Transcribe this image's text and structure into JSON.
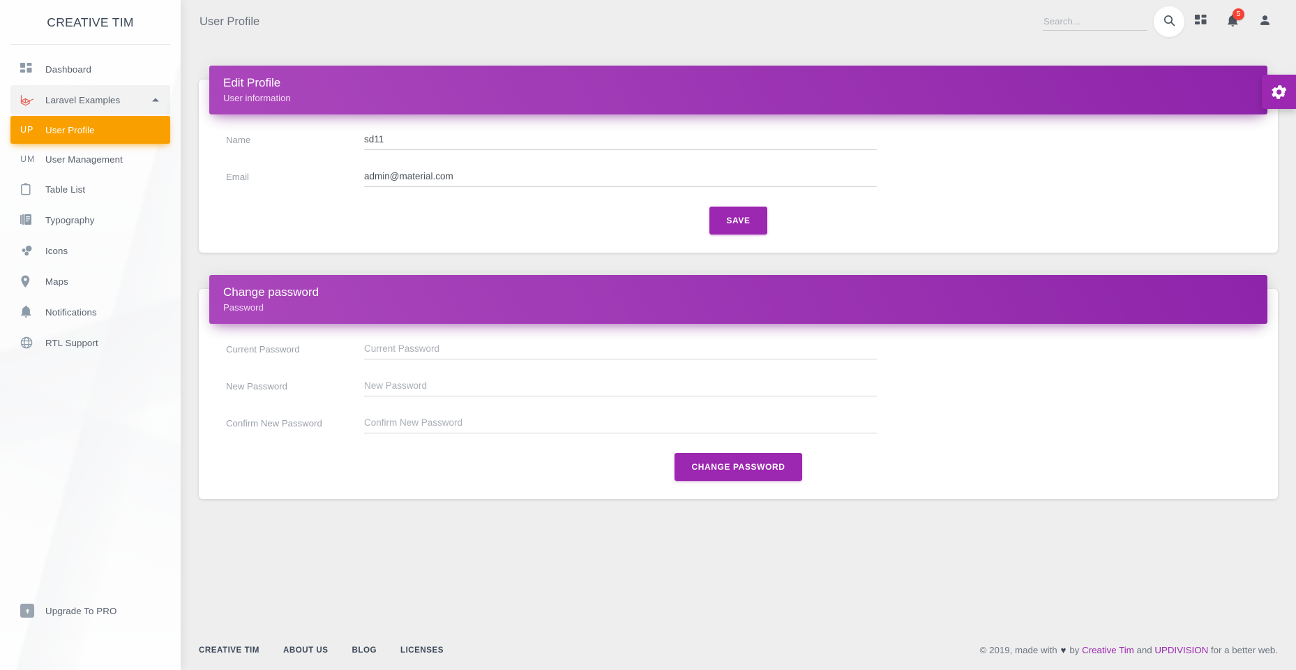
{
  "sidebar": {
    "brand": "CREATIVE TIM",
    "items": [
      {
        "label": "Dashboard",
        "icon": "dashboard-icon",
        "type": "icon",
        "state": "default"
      },
      {
        "label": "Laravel Examples",
        "icon": "laravel-icon",
        "type": "icon",
        "state": "expanded",
        "caret": "chevron-up-icon"
      },
      {
        "label": "User Profile",
        "mini": "UP",
        "type": "mini",
        "state": "active"
      },
      {
        "label": "User Management",
        "mini": "UM",
        "type": "mini",
        "state": "default"
      },
      {
        "label": "Table List",
        "icon": "clipboard-icon",
        "type": "icon",
        "state": "default"
      },
      {
        "label": "Typography",
        "icon": "library-books-icon",
        "type": "icon",
        "state": "default"
      },
      {
        "label": "Icons",
        "icon": "bubble-chart-icon",
        "type": "icon",
        "state": "default"
      },
      {
        "label": "Maps",
        "icon": "location-pin-icon",
        "type": "icon",
        "state": "default"
      },
      {
        "label": "Notifications",
        "icon": "bell-icon",
        "type": "icon",
        "state": "default"
      },
      {
        "label": "RTL Support",
        "icon": "globe-icon",
        "type": "icon",
        "state": "default"
      }
    ],
    "upgrade": {
      "label": "Upgrade To PRO",
      "icon": "unarchive-icon"
    },
    "active_color": "#f9a000"
  },
  "navbar": {
    "page_title": "User Profile",
    "search": {
      "value": "",
      "placeholder": "Search..."
    },
    "search_button_icon": "search-icon",
    "actions": [
      {
        "name": "dashboard-grid-button",
        "icon": "grid-icon",
        "badge": ""
      },
      {
        "name": "notifications-button",
        "icon": "bell-icon",
        "badge": "5"
      },
      {
        "name": "account-button",
        "icon": "person-icon",
        "badge": ""
      }
    ],
    "badge_color": "#f44336"
  },
  "settings_tab": {
    "icon": "gear-icon",
    "color": "#9c27b0"
  },
  "cards": {
    "edit_profile": {
      "title": "Edit Profile",
      "subtitle": "User information",
      "header_color": "#9c27b0",
      "fields": [
        {
          "label": "Name",
          "value": "sd11",
          "placeholder": "",
          "type": "text"
        },
        {
          "label": "Email",
          "value": "admin@material.com",
          "placeholder": "",
          "type": "email"
        }
      ],
      "submit_label": "SAVE"
    },
    "change_password": {
      "title": "Change password",
      "subtitle": "Password",
      "header_color": "#9c27b0",
      "fields": [
        {
          "label": "Current Password",
          "value": "",
          "placeholder": "Current Password",
          "type": "password"
        },
        {
          "label": "New Password",
          "value": "",
          "placeholder": "New Password",
          "type": "password"
        },
        {
          "label": "Confirm New Password",
          "value": "",
          "placeholder": "Confirm New Password",
          "type": "password"
        }
      ],
      "submit_label": "CHANGE PASSWORD"
    }
  },
  "footer": {
    "links": [
      "CREATIVE TIM",
      "ABOUT US",
      "BLOG",
      "LICENSES"
    ],
    "copyright_prefix": "© 2019, made with",
    "heart": "♥",
    "by": "by",
    "link1": "Creative Tim",
    "and": "and",
    "link2": "UPDIVISION",
    "copyright_suffix": "for a better web.",
    "link_color": "#9c27b0"
  }
}
